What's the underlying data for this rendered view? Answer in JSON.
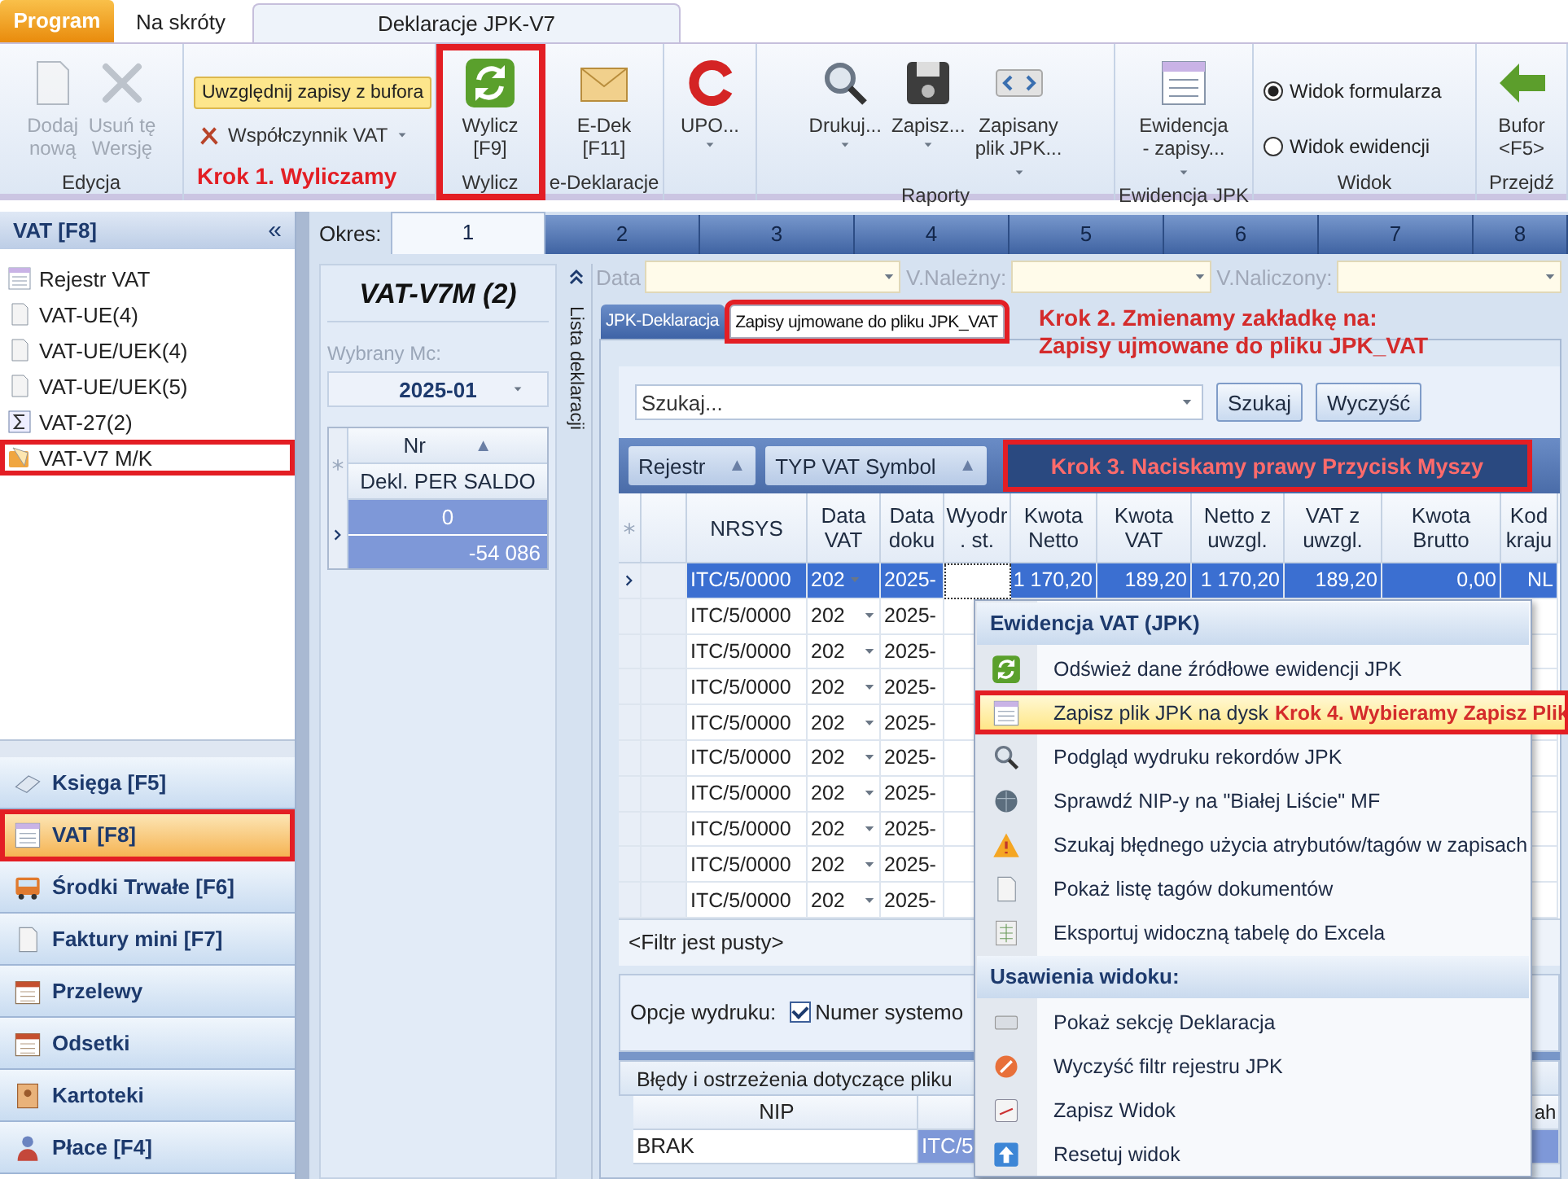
{
  "app_tabs": [
    {
      "label": "Program",
      "kind": "app",
      "selected": false
    },
    {
      "label": "Na skróty",
      "kind": "tab",
      "selected": false
    },
    {
      "label": "Deklaracje JPK-V7",
      "kind": "tab",
      "selected": true
    }
  ],
  "ribbon": [
    {
      "label": "Edycja",
      "annotated": false,
      "items": [
        {
          "kind": "large",
          "label": "Dodaj\nnową",
          "disabled": true,
          "menu": false
        },
        {
          "kind": "large",
          "label": "Usuń tę\nWersję",
          "disabled": true,
          "menu": false
        }
      ]
    },
    {
      "annotated": false,
      "items": [
        {
          "kind": "toggle",
          "label": "Uwzględnij zapisy z bufora",
          "on": true
        },
        {
          "kind": "dropdown",
          "label": "Współczynnik VAT"
        },
        {
          "kind": "note",
          "label": "Krok 1. Wyliczamy"
        }
      ]
    },
    {
      "label": "Wylicz",
      "annotated": true,
      "items": [
        {
          "kind": "large",
          "label": "Wylicz\n[F9]",
          "disabled": false,
          "menu": false
        }
      ]
    },
    {
      "label": "e-Deklaracje",
      "annotated": false,
      "items": [
        {
          "kind": "large",
          "label": "E-Dek\n[F11]",
          "disabled": false,
          "menu": false
        }
      ]
    },
    {
      "annotated": false,
      "items": [
        {
          "kind": "large",
          "label": "UPO...",
          "disabled": false,
          "menu": true
        }
      ]
    },
    {
      "label": "Raporty",
      "annotated": false,
      "items": [
        {
          "kind": "large",
          "label": "Drukuj...",
          "disabled": false,
          "menu": true
        },
        {
          "kind": "large",
          "label": "Zapisz...",
          "disabled": false,
          "menu": true
        },
        {
          "kind": "large",
          "label": "Zapisany\nplik JPK...",
          "disabled": false,
          "menu": true
        }
      ]
    },
    {
      "label": "Ewidencja JPK",
      "annotated": false,
      "items": [
        {
          "kind": "large",
          "label": "Ewidencja\n- zapisy...",
          "disabled": false,
          "menu": true
        }
      ]
    },
    {
      "label": "Widok",
      "annotated": false,
      "items": [
        {
          "kind": "radio",
          "label": "Widok formularza",
          "selected": true
        },
        {
          "kind": "radio",
          "label": "Widok ewidencji",
          "selected": false
        }
      ]
    },
    {
      "label": "Przejdź",
      "annotated": false,
      "items": [
        {
          "kind": "large",
          "label": "Bufor\n<F5>",
          "disabled": false,
          "menu": false
        }
      ]
    }
  ],
  "sidebar": {
    "title": "VAT [F8]",
    "collapse": "«",
    "items": [
      {
        "label": "Rejestr VAT",
        "annotated": false
      },
      {
        "label": "VAT-UE(4)",
        "annotated": false
      },
      {
        "label": "VAT-UE/UEK(4)",
        "annotated": false
      },
      {
        "label": "VAT-UE/UEK(5)",
        "annotated": false
      },
      {
        "label": "VAT-27(2)",
        "annotated": false
      },
      {
        "label": "VAT-V7 M/K",
        "annotated": true
      }
    ],
    "nav": [
      {
        "label": "Księga [F5]",
        "selected": false,
        "annotated": false
      },
      {
        "label": "VAT [F8]",
        "selected": true,
        "annotated": true
      },
      {
        "label": "Środki Trwałe [F6]",
        "selected": false,
        "annotated": false
      },
      {
        "label": "Faktury mini [F7]",
        "selected": false,
        "annotated": false
      },
      {
        "label": "Przelewy",
        "selected": false,
        "annotated": false
      },
      {
        "label": "Odsetki",
        "selected": false,
        "annotated": false
      },
      {
        "label": "Kartoteki",
        "selected": false,
        "annotated": false
      },
      {
        "label": "Płace [F4]",
        "selected": false,
        "annotated": false
      }
    ]
  },
  "period": {
    "label": "Okres:",
    "tabs": [
      {
        "label": "1",
        "selected": true
      },
      {
        "label": "2",
        "selected": false
      },
      {
        "label": "3",
        "selected": false
      },
      {
        "label": "4",
        "selected": false
      },
      {
        "label": "5",
        "selected": false
      },
      {
        "label": "6",
        "selected": false
      },
      {
        "label": "7",
        "selected": false
      },
      {
        "label": "8",
        "selected": false
      }
    ]
  },
  "declarations": {
    "title": "VAT-V7M (2)",
    "month_label": "Wybrany Mc:",
    "month": "2025-01",
    "columns": [
      {
        "label": "Nr",
        "sort": "▲"
      },
      {
        "label": "Dekl. PER SALDO"
      }
    ],
    "rows": [
      {
        "cells": [
          "0",
          "-54 086"
        ],
        "selected": true
      }
    ],
    "side_tab": "Lista deklaracji"
  },
  "filters": [
    {
      "label": "Data"
    },
    {
      "label": "V.Należny:"
    },
    {
      "label": "V.Naliczony:"
    }
  ],
  "subtabs": [
    {
      "label": "JPK-Deklaracja",
      "selected": false,
      "annotated": false
    },
    {
      "label": "Zapisy ujmowane do pliku JPK_VAT",
      "selected": true,
      "annotated": true
    }
  ],
  "step2_note": [
    "Krok 2. Zmienamy zakładkę na:",
    "Zapisy ujmowane do pliku JPK_VAT"
  ],
  "search": {
    "placeholder": "Szukaj...",
    "buttons": [
      "Szukaj",
      "Wyczyść"
    ]
  },
  "group_by": [
    {
      "label": "Rejestr",
      "sort": "▲"
    },
    {
      "label": "TYP VAT Symbol",
      "sort": "▲"
    }
  ],
  "step3_note": "Krok 3. Naciskamy prawy Przycisk Myszy",
  "grid": {
    "columns": [
      {
        "label": "NRSYS",
        "kind": "text"
      },
      {
        "label": "Data\nVAT",
        "kind": "dropdown"
      },
      {
        "label": "Data\ndoku",
        "kind": "text"
      },
      {
        "label": "Wyodr\n. st.",
        "kind": "text"
      },
      {
        "label": "Kwota\nNetto",
        "kind": "text"
      },
      {
        "label": "Kwota\nVAT",
        "kind": "text"
      },
      {
        "label": "Netto z\nuwzgl.",
        "kind": "text"
      },
      {
        "label": "VAT z\nuwzgl.",
        "kind": "text"
      },
      {
        "label": "Kwota\nBrutto",
        "kind": "text"
      },
      {
        "label": "Kod\nkraju",
        "kind": "text"
      }
    ],
    "rows": [
      {
        "cells": [
          "ITC/5/0000",
          "202",
          "2025-",
          null,
          "1 170,20",
          "189,20",
          "1 170,20",
          "189,20",
          "0,00",
          "NL"
        ],
        "selected": true
      },
      {
        "cells": [
          "ITC/5/0000",
          "202",
          "2025-",
          null,
          null,
          null,
          null,
          null,
          null,
          null
        ],
        "selected": false
      },
      {
        "cells": [
          "ITC/5/0000",
          "202",
          "2025-",
          null,
          null,
          null,
          null,
          null,
          null,
          null
        ],
        "selected": false
      },
      {
        "cells": [
          "ITC/5/0000",
          "202",
          "2025-",
          null,
          null,
          null,
          null,
          null,
          null,
          null
        ],
        "selected": false
      },
      {
        "cells": [
          "ITC/5/0000",
          "202",
          "2025-",
          null,
          null,
          null,
          null,
          null,
          null,
          null
        ],
        "selected": false
      },
      {
        "cells": [
          "ITC/5/0000",
          "202",
          "2025-",
          null,
          null,
          null,
          null,
          null,
          null,
          null
        ],
        "selected": false
      },
      {
        "cells": [
          "ITC/5/0000",
          "202",
          "2025-",
          null,
          null,
          null,
          null,
          null,
          null,
          null
        ],
        "selected": false
      },
      {
        "cells": [
          "ITC/5/0000",
          "202",
          "2025-",
          null,
          null,
          null,
          null,
          null,
          null,
          null
        ],
        "selected": false
      },
      {
        "cells": [
          "ITC/5/0000",
          "202",
          "2025-",
          null,
          null,
          null,
          null,
          null,
          null,
          null
        ],
        "selected": false
      },
      {
        "cells": [
          "ITC/5/0000",
          "202",
          "2025-",
          null,
          null,
          null,
          null,
          null,
          null,
          null
        ],
        "selected": false
      }
    ]
  },
  "filter_status": "<Filtr jest pusty>",
  "print_options": {
    "label": "Opcje wydruku:",
    "checkbox": {
      "label": "Numer systemo",
      "checked": true
    }
  },
  "errors": {
    "title": "Błędy i ostrzeżenia dotyczące pliku",
    "columns": [
      "NIP",
      null,
      "ah"
    ],
    "rows": [
      {
        "cells": [
          "BRAK",
          "ITC/5",
          null
        ],
        "selected": true
      }
    ]
  },
  "context_menu": {
    "sections": [
      {
        "title": "Ewidencja VAT (JPK)",
        "items": [
          {
            "label": "Odśwież dane źródłowe ewidencji JPK",
            "highlighted": false,
            "annotated": false
          },
          {
            "label": "Zapisz plik JPK na dysk",
            "highlighted": true,
            "annotated": true,
            "note": "Krok 4. Wybieramy Zapisz Plik"
          },
          {
            "label": "Podgląd wydruku rekordów JPK",
            "highlighted": false,
            "annotated": false
          },
          {
            "label": "Sprawdź NIP-y na \"Białej Liście\" MF",
            "highlighted": false,
            "annotated": false
          },
          {
            "label": "Szukaj błędnego użycia atrybutów/tagów w zapisach",
            "highlighted": false,
            "annotated": false
          },
          {
            "label": "Pokaż listę tagów dokumentów",
            "highlighted": false,
            "annotated": false
          },
          {
            "label": "Eksportuj widoczną tabelę do Excela",
            "highlighted": false,
            "annotated": false
          }
        ]
      },
      {
        "title": "Usawienia widoku:",
        "items": [
          {
            "label": "Pokaż sekcję Deklaracja",
            "highlighted": false,
            "annotated": false
          },
          {
            "label": "Wyczyść filtr rejestru JPK",
            "highlighted": false,
            "annotated": false
          },
          {
            "label": "Zapisz Widok",
            "highlighted": false,
            "annotated": false
          },
          {
            "label": "Resetuj widok",
            "highlighted": false,
            "annotated": false
          }
        ]
      }
    ]
  }
}
